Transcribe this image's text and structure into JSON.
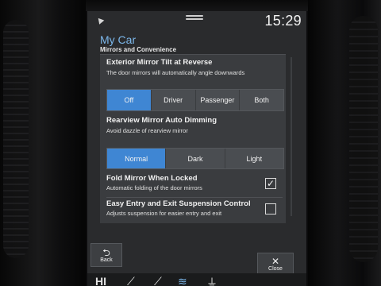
{
  "status_bar": {
    "time": "15:29",
    "nav_icon": "navigation-arrow-icon"
  },
  "header": {
    "title": "My Car",
    "subtitle": "Mirrors and Convenience"
  },
  "settings": {
    "exterior_mirror": {
      "title": "Exterior Mirror Tilt at Reverse",
      "description": "The door mirrors will automatically angle downwards",
      "options": [
        "Off",
        "Driver",
        "Passenger",
        "Both"
      ],
      "selected": "Off"
    },
    "rearview_dimming": {
      "title": "Rearview Mirror Auto Dimming",
      "description": "Avoid dazzle of rearview mirror",
      "options": [
        "Normal",
        "Dark",
        "Light"
      ],
      "selected": "Normal"
    },
    "fold_mirror": {
      "title": "Fold Mirror When Locked",
      "description": "Automatic folding of the door mirrors",
      "checked": true
    },
    "easy_entry": {
      "title": "Easy Entry and Exit Suspension Control",
      "description": "Adjusts suspension for easier entry and exit",
      "checked": false
    }
  },
  "footer": {
    "back_label": "Back",
    "close_label": "Close",
    "climate_text": "HI"
  },
  "colors": {
    "accent": "#3f86d3",
    "title": "#7cb7ea",
    "panel": "#3a3c3f"
  }
}
